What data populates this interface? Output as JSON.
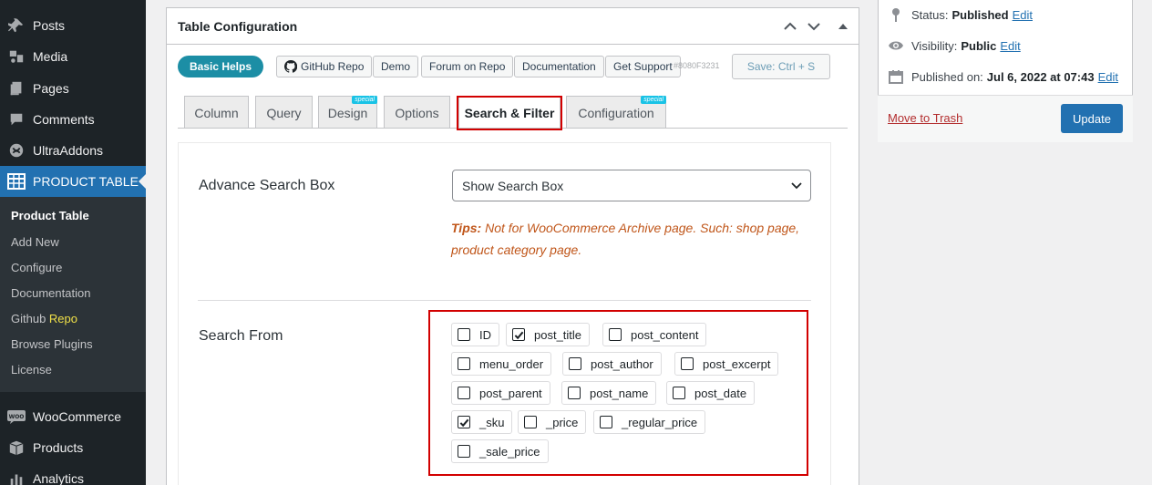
{
  "sidebar": {
    "items": [
      {
        "label": "Posts",
        "icon": "pin-icon"
      },
      {
        "label": "Media",
        "icon": "media-icon"
      },
      {
        "label": "Pages",
        "icon": "pages-icon"
      },
      {
        "label": "Comments",
        "icon": "comments-icon"
      },
      {
        "label": "UltraAddons",
        "icon": "ultraaddons-icon"
      },
      {
        "label": "PRODUCT TABLE",
        "icon": "table-icon"
      },
      {
        "label": "WooCommerce",
        "icon": "woocommerce-icon"
      },
      {
        "label": "Products",
        "icon": "products-icon"
      },
      {
        "label": "Analytics",
        "icon": "analytics-icon"
      }
    ],
    "submenu": [
      {
        "label": "Product Table"
      },
      {
        "label": "Add New"
      },
      {
        "label": "Configure"
      },
      {
        "label": "Documentation"
      },
      {
        "label": "Github ",
        "highlight": "Repo"
      },
      {
        "label": "Browse Plugins"
      },
      {
        "label": "License"
      }
    ],
    "woo_badge": "WOO"
  },
  "panel": {
    "title": "Table Configuration",
    "basic_helps": "Basic Helps",
    "links": [
      "GitHub Repo",
      "Demo",
      "Forum on Repo",
      "Documentation",
      "Get Support"
    ],
    "version": "#8080F3231",
    "save_label": "Save: Ctrl + S"
  },
  "tabs": [
    {
      "label": "Column"
    },
    {
      "label": "Query"
    },
    {
      "label": "Design",
      "badge": "special"
    },
    {
      "label": "Options"
    },
    {
      "label": "Search & Filter",
      "active": true
    },
    {
      "label": "Configuration",
      "badge": "special"
    }
  ],
  "search_box": {
    "label": "Advance Search Box",
    "selected": "Show Search Box",
    "tips_prefix": "Tips:",
    "tips_text": " Not for WooCommerce Archive page. Such: shop page, product category page."
  },
  "search_from": {
    "label": "Search From",
    "options": [
      {
        "label": "ID",
        "checked": false
      },
      {
        "label": "post_title",
        "checked": true
      },
      {
        "label": "post_content",
        "checked": false
      },
      {
        "label": "menu_order",
        "checked": false
      },
      {
        "label": "post_author",
        "checked": false
      },
      {
        "label": "post_excerpt",
        "checked": false
      },
      {
        "label": "post_parent",
        "checked": false
      },
      {
        "label": "post_name",
        "checked": false
      },
      {
        "label": "post_date",
        "checked": false
      },
      {
        "label": "_sku",
        "checked": true
      },
      {
        "label": "_price",
        "checked": false
      },
      {
        "label": "_regular_price",
        "checked": false
      },
      {
        "label": "_sale_price",
        "checked": false
      }
    ]
  },
  "publish": {
    "status_label": "Status:",
    "status_value": "Published",
    "visibility_label": "Visibility:",
    "visibility_value": "Public",
    "published_label": "Published on:",
    "published_value": "Jul 6, 2022 at 07:43",
    "edit": "Edit",
    "trash": "Move to Trash",
    "update": "Update"
  },
  "colors": {
    "sidebar_bg": "#1d2327",
    "accent": "#2271b1",
    "highlight_red": "#d20000",
    "basic_helps": "#1c8ea5",
    "tips": "#c0561a"
  }
}
